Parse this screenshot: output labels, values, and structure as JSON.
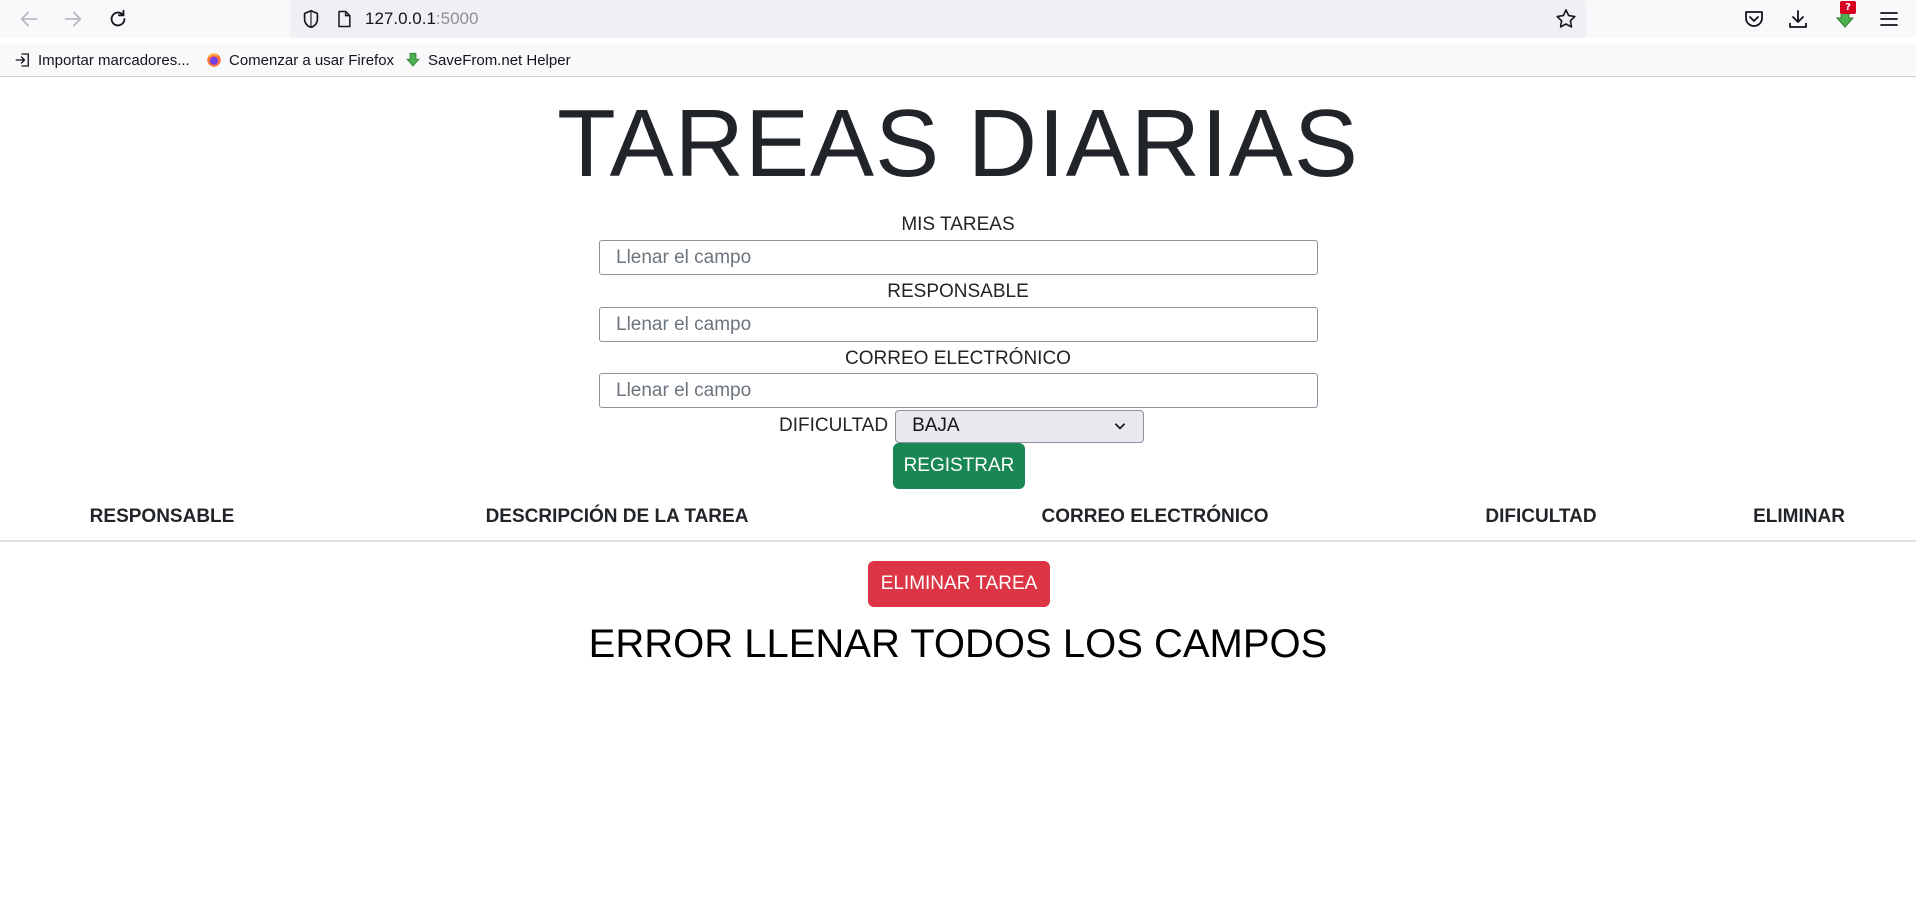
{
  "browser": {
    "url_host": "127.0.0.1",
    "url_port": ":5000",
    "badge": "?",
    "bookmarks": [
      {
        "label": "Importar marcadores..."
      },
      {
        "label": "Comenzar a usar Firefox"
      },
      {
        "label": "SaveFrom.net Helper"
      }
    ]
  },
  "page": {
    "title": "TAREAS DIARIAS",
    "form": {
      "task_label": "MIS TAREAS",
      "task_placeholder": "Llenar el campo",
      "owner_label": "RESPONSABLE",
      "owner_placeholder": "Llenar el campo",
      "email_label": "CORREO ELECTRÓNICO",
      "email_placeholder": "Llenar el campo",
      "difficulty_label": "DIFICULTAD",
      "difficulty_value": "BAJA",
      "register_button": "REGISTRAR"
    },
    "table": {
      "headers": [
        "RESPONSABLE",
        "DESCRIPCIÓN DE LA TAREA",
        "CORREO ELECTRÓNICO",
        "DIFICULTAD",
        "ELIMINAR"
      ]
    },
    "delete_button": "ELIMINAR TAREA",
    "error_message": "ERROR LLENAR TODOS LOS CAMPOS"
  },
  "colors": {
    "register": "#198754",
    "delete": "#dc3545",
    "text": "#212529"
  }
}
